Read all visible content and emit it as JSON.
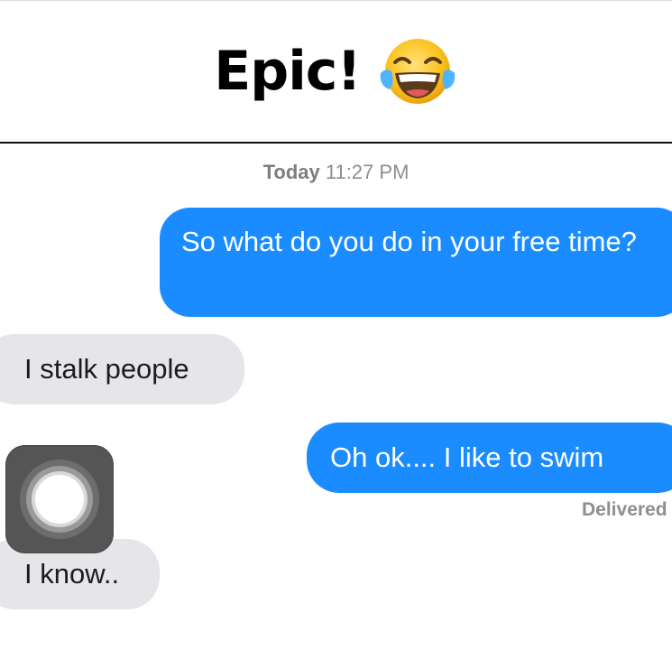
{
  "caption": {
    "text": "Epic!",
    "emoji": "face-with-tears-of-joy-icon"
  },
  "thread": {
    "timestamp_day": "Today",
    "timestamp_time": "11:27 PM",
    "messages": [
      {
        "direction": "outgoing",
        "text": "So what do you do in your free time?"
      },
      {
        "direction": "incoming",
        "text": "I stalk people"
      },
      {
        "direction": "outgoing",
        "text": "Oh ok.... I like to swim"
      },
      {
        "direction": "incoming",
        "text": "I know.."
      }
    ],
    "delivered_label": "Delivered"
  },
  "colors": {
    "outgoing_bubble": "#1a8cff",
    "incoming_bubble": "#e5e5ea"
  },
  "assistive_touch": {
    "icon": "assistive-touch-icon"
  }
}
